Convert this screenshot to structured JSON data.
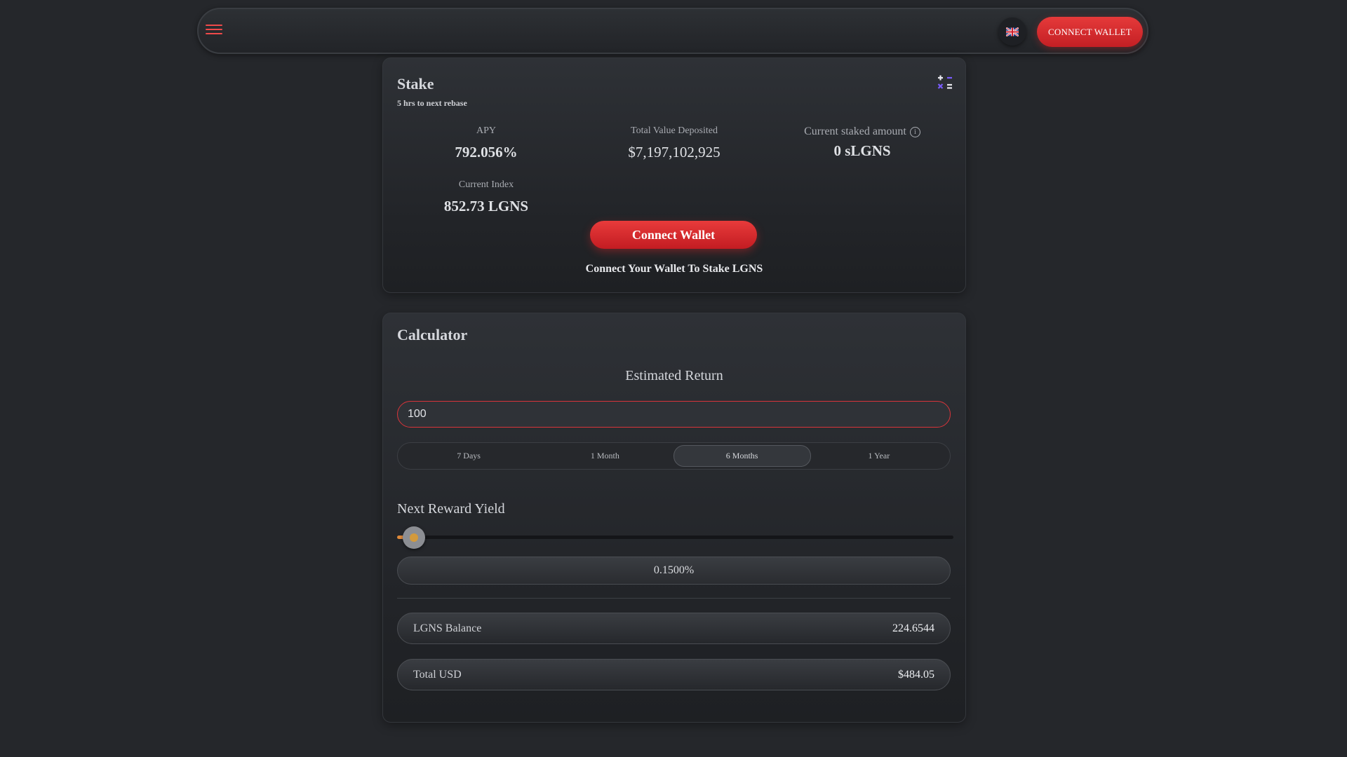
{
  "nav": {
    "connect_wallet_label": "CONNECT WALLET",
    "language_icon": "uk-flag-icon",
    "menu_icon": "hamburger-menu-icon",
    "accent_color": "#e53a3a"
  },
  "stake": {
    "title": "Stake",
    "subtitle": "5 hrs to next rebase",
    "icon": "calculator-icon",
    "apy_label": "APY",
    "apy_value": "792.056%",
    "tvd_label": "Total Value Deposited",
    "tvd_value": "$7,197,102,925",
    "staked_label": "Current staked amount",
    "staked_value": "0 sLGNS",
    "index_label": "Current Index",
    "index_value": "852.73 LGNS",
    "connect_button": "Connect Wallet",
    "connect_message": "Connect Your Wallet To Stake LGNS"
  },
  "calculator": {
    "title": "Calculator",
    "estimated_return_label": "Estimated Return",
    "amount_value": "100",
    "periods": [
      "7 Days",
      "1 Month",
      "6 Months",
      "1 Year"
    ],
    "selected_period": "6 Months",
    "next_reward_yield_label": "Next Reward Yield",
    "slider_fraction": 0.03,
    "yield_value": "0.1500%",
    "balance_label": "LGNS Balance",
    "balance_value": "224.6544",
    "total_usd_label": "Total USD",
    "total_usd_value": "$484.05"
  }
}
